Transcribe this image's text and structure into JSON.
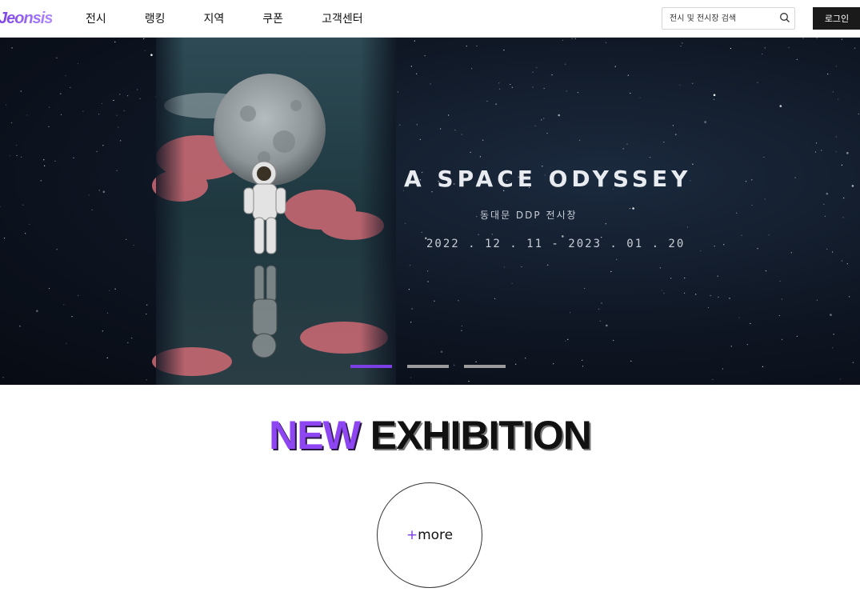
{
  "header": {
    "logo": "Jeonsis",
    "nav": [
      "전시",
      "랭킹",
      "지역",
      "쿠폰",
      "고객센터"
    ],
    "search_placeholder": "전시 및 전시장 검색",
    "login_label": "로그인"
  },
  "hero": {
    "title": "A SPACE ODYSSEY",
    "venue": "동대문 DDP 전시장",
    "dates": "2022 . 12 . 11 - 2023 . 01 . 20",
    "slide_count": 3,
    "active_slide": 1
  },
  "section": {
    "title_accent": "NEW",
    "title_rest": "EXHIBITION",
    "more_plus": "+",
    "more_label": "more"
  },
  "colors": {
    "accent": "#7b3fe4",
    "login_bg": "#1a1a1a"
  },
  "icons": {
    "search": "search-icon"
  }
}
